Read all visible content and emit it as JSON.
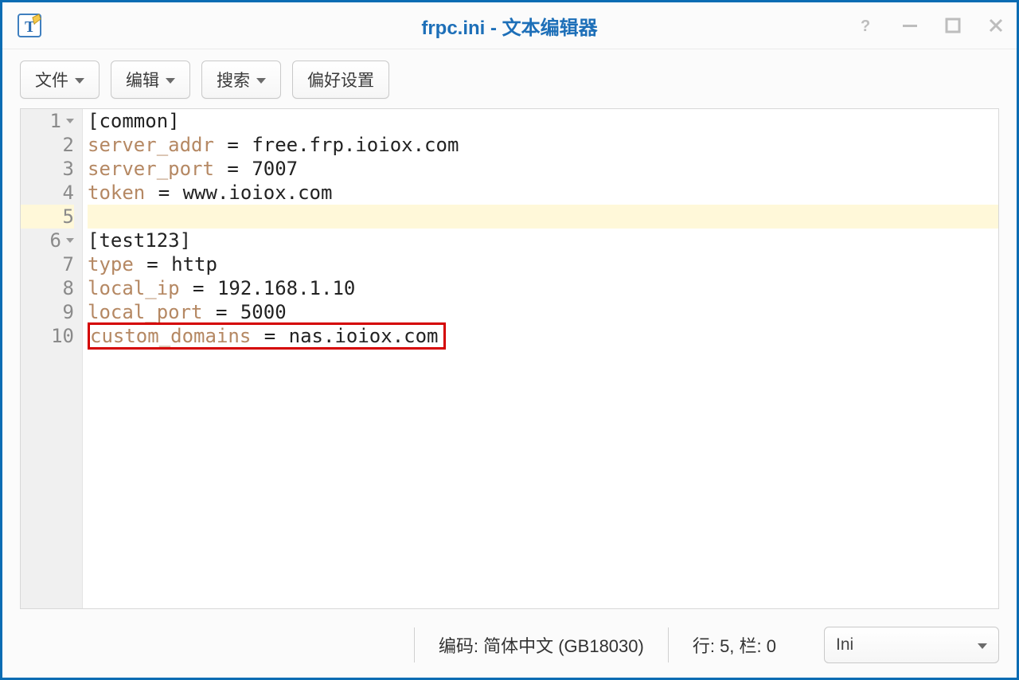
{
  "window": {
    "title": "frpc.ini - 文本编辑器"
  },
  "toolbar": {
    "file": "文件",
    "edit": "编辑",
    "search": "搜索",
    "prefs": "偏好设置"
  },
  "editor": {
    "gutter": [
      "1",
      "2",
      "3",
      "4",
      "5",
      "6",
      "7",
      "8",
      "9",
      "10"
    ],
    "foldable": [
      true,
      false,
      false,
      false,
      false,
      true,
      false,
      false,
      false,
      false
    ],
    "highlighted": [
      false,
      false,
      false,
      false,
      true,
      false,
      false,
      false,
      false,
      false
    ],
    "annotated": [
      false,
      false,
      false,
      false,
      false,
      false,
      false,
      false,
      false,
      true
    ],
    "lines": [
      {
        "section": "[common]"
      },
      {
        "key": "server_addr",
        "value": "free.frp.ioiox.com"
      },
      {
        "key": "server_port",
        "value": "7007"
      },
      {
        "key": "token",
        "value": "www.ioiox.com"
      },
      {
        "blank": true
      },
      {
        "section": "[test123]"
      },
      {
        "key": "type",
        "value": "http"
      },
      {
        "key": "local_ip",
        "value": "192.168.1.10"
      },
      {
        "key": "local_port",
        "value": "5000"
      },
      {
        "key": "custom_domains",
        "value": "nas.ioiox.com"
      }
    ]
  },
  "status": {
    "encoding_label": "编码: 简体中文 (GB18030)",
    "cursor_label": "行: 5, 栏: 0",
    "syntax": "Ini"
  }
}
